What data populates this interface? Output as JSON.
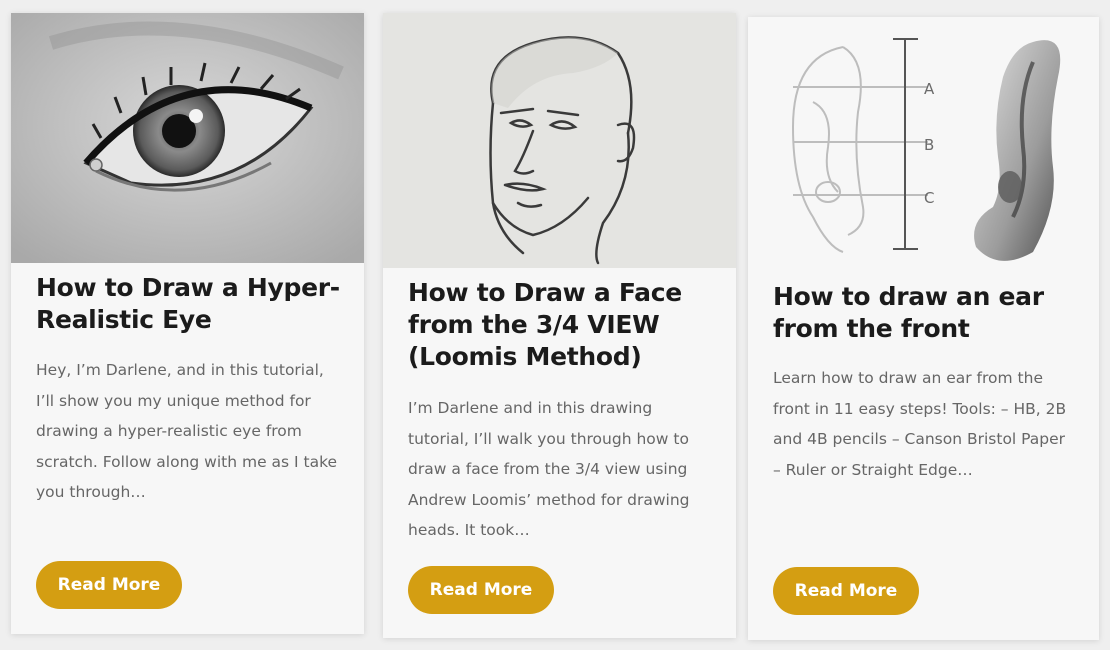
{
  "posts": [
    {
      "title": "How to Draw a Hyper-Realistic Eye",
      "excerpt": "Hey, I’m Darlene, and in this tutorial, I’ll show you my unique method for drawing a hyper-realistic eye from scratch. Follow along with me as I take you through…",
      "button": "Read More"
    },
    {
      "title": "How to Draw a Face from the 3/4 VIEW (Loomis Method)",
      "excerpt": "I’m Darlene and in this drawing tutorial, I’ll walk you through how to draw a face from the 3/4 view using Andrew Loomis’ method for drawing heads. It took…",
      "button": "Read More"
    },
    {
      "title": "How to draw an ear from the front",
      "excerpt": "Learn how to draw an ear from the front in 11 easy steps! Tools: – HB, 2B and 4B pencils – Canson Bristol Paper – Ruler or Straight Edge…",
      "button": "Read More",
      "diagram_labels": [
        "A",
        "B",
        "C"
      ]
    }
  ],
  "colors": {
    "accent": "#d49e12",
    "title": "#1b1b1b",
    "text": "#666666",
    "card": "#f7f7f7"
  }
}
